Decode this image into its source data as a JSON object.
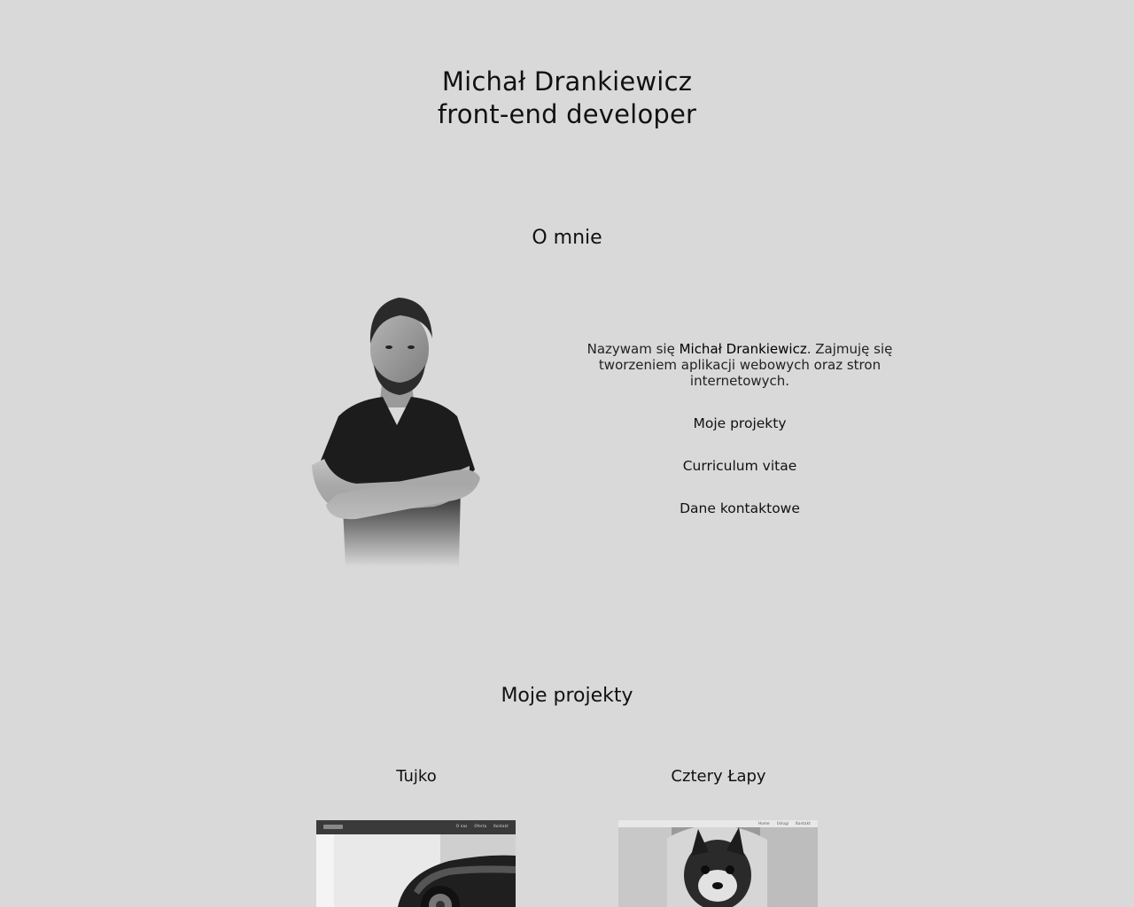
{
  "header": {
    "name": "Michał Drankiewicz",
    "role": "front-end developer"
  },
  "about": {
    "title": "O mnie",
    "intro_before": "Nazywam się ",
    "intro_name": "Michał Drankiewicz",
    "intro_after": ". Zajmuję się tworzeniem aplikacji webowych oraz stron internetowych.",
    "links": [
      "Moje projekty",
      "Curriculum vitae",
      "Dane kontaktowe"
    ]
  },
  "projects": {
    "title": "Moje projekty",
    "items": [
      {
        "name": "Tujko",
        "thumb_nav": [
          "O nas",
          "Oferta",
          "Kontakt"
        ]
      },
      {
        "name": "Cztery Łapy",
        "thumb_nav": [
          "Home",
          "Usługi",
          "Kontakt"
        ]
      }
    ]
  },
  "colors": {
    "background": "#d9d9d9",
    "text": "#111111"
  }
}
